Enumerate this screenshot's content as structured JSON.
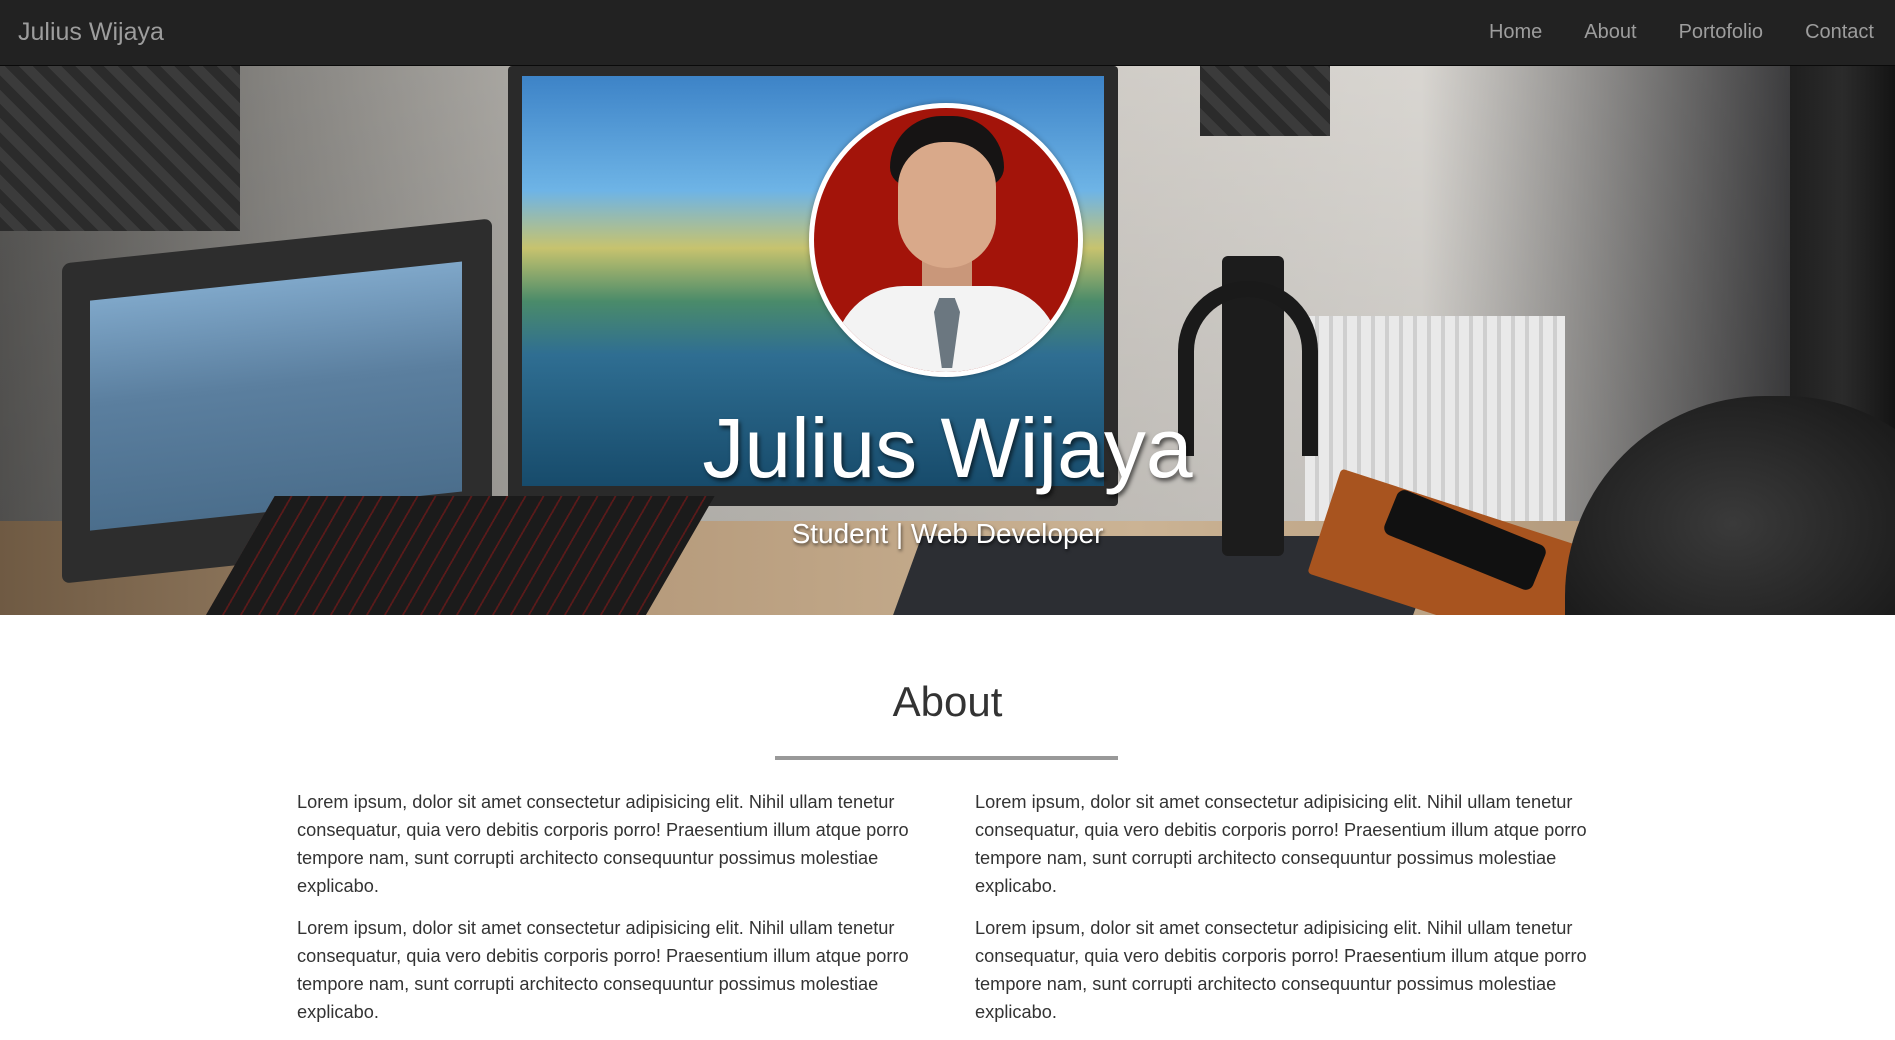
{
  "navbar": {
    "brand": "Julius Wijaya",
    "links": [
      "Home",
      "About",
      "Portofolio",
      "Contact"
    ]
  },
  "hero": {
    "name": "Julius Wijaya",
    "subtitle": "Student | Web Developer"
  },
  "about": {
    "title": "About",
    "left_column": [
      "Lorem ipsum, dolor sit amet consectetur adipisicing elit. Nihil ullam tenetur consequatur, quia vero debitis corporis porro! Praesentium illum atque porro tempore nam, sunt corrupti architecto consequuntur possimus molestiae explicabo.",
      "Lorem ipsum, dolor sit amet consectetur adipisicing elit. Nihil ullam tenetur consequatur, quia vero debitis corporis porro! Praesentium illum atque porro tempore nam, sunt corrupti architecto consequuntur possimus molestiae explicabo."
    ],
    "right_column": [
      "Lorem ipsum, dolor sit amet consectetur adipisicing elit. Nihil ullam tenetur consequatur, quia vero debitis corporis porro! Praesentium illum atque porro tempore nam, sunt corrupti architecto consequuntur possimus molestiae explicabo.",
      "Lorem ipsum, dolor sit amet consectetur adipisicing elit. Nihil ullam tenetur consequatur, quia vero debitis corporis porro! Praesentium illum atque porro tempore nam, sunt corrupti architecto consequuntur possimus molestiae explicabo."
    ]
  },
  "colors": {
    "navbar_bg": "#222222",
    "nav_text": "#9d9d9d",
    "avatar_bg": "#a3140a",
    "divider": "#999999"
  }
}
